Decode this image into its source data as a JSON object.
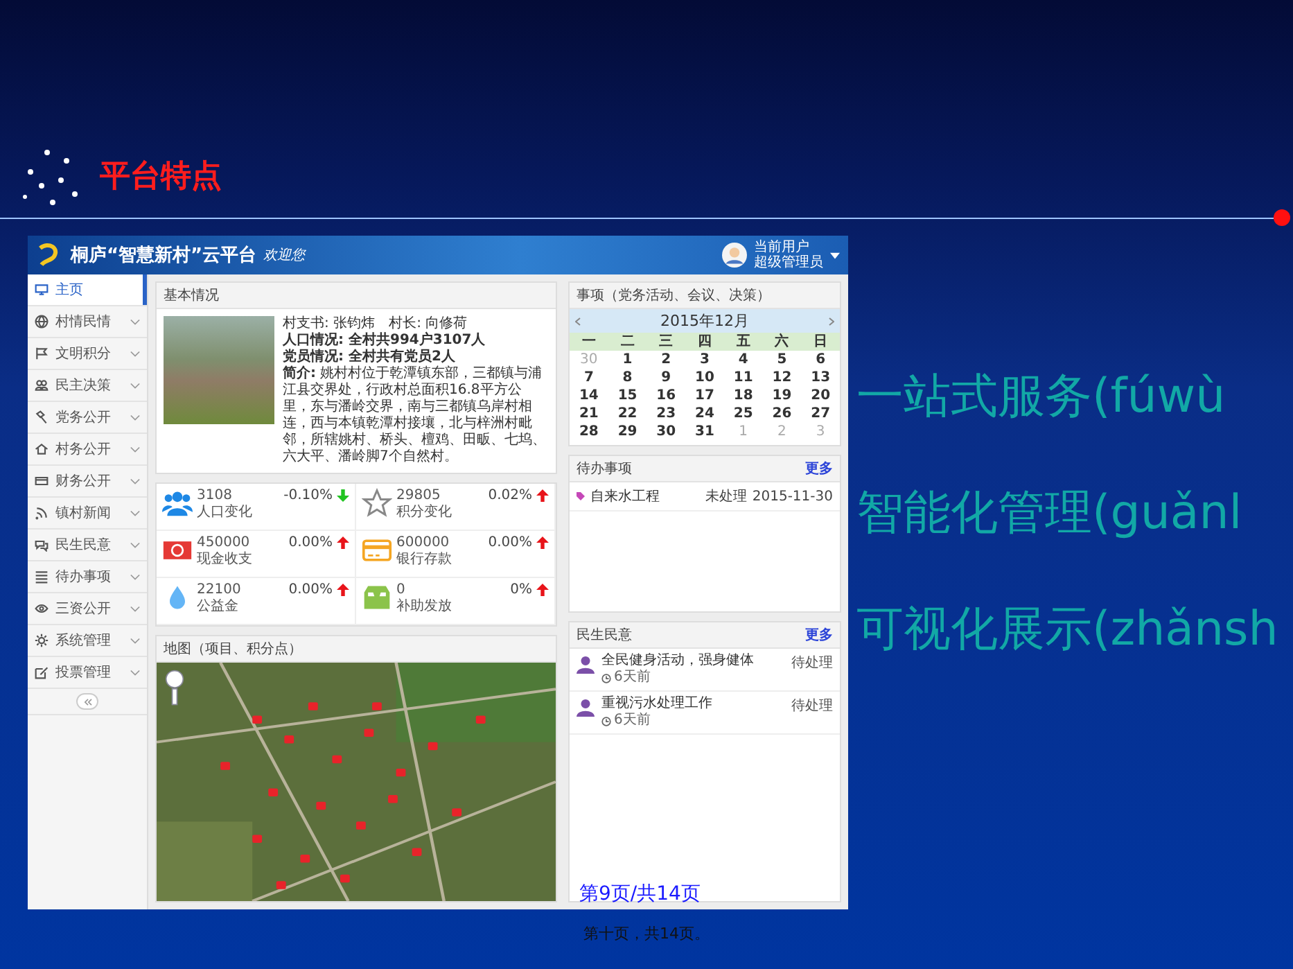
{
  "slide": {
    "title": "平台特点",
    "points": [
      "一站式服务(fúwù",
      "智能化管理(guǎnl",
      "可视化展示(zhǎnsh"
    ],
    "page_note": "第9页/共14页",
    "footer": "第十页，共14页。"
  },
  "app": {
    "brand": "桐庐“智慧新村”云平台",
    "welcome": "欢迎您",
    "user": {
      "role": "当前用户",
      "name": "超级管理员"
    }
  },
  "sidebar": {
    "items": [
      {
        "label": "主页",
        "kind": "monitor",
        "selected": true
      },
      {
        "label": "村情民情",
        "kind": "globe",
        "selected": false
      },
      {
        "label": "文明积分",
        "kind": "flag",
        "selected": false
      },
      {
        "label": "民主决策",
        "kind": "people",
        "selected": false
      },
      {
        "label": "党务公开",
        "kind": "hammer",
        "selected": false
      },
      {
        "label": "村务公开",
        "kind": "house",
        "selected": false
      },
      {
        "label": "财务公开",
        "kind": "card",
        "selected": false
      },
      {
        "label": "镇村新闻",
        "kind": "rss",
        "selected": false
      },
      {
        "label": "民生民意",
        "kind": "chat",
        "selected": false
      },
      {
        "label": "待办事项",
        "kind": "list",
        "selected": false
      },
      {
        "label": "三资公开",
        "kind": "eye",
        "selected": false
      },
      {
        "label": "系统管理",
        "kind": "gear",
        "selected": false
      },
      {
        "label": "投票管理",
        "kind": "edit",
        "selected": false
      }
    ]
  },
  "basic_info": {
    "title": "基本情况",
    "leaders": [
      "村支书: 张钧炜",
      "村长: 向修荷"
    ],
    "lines": [
      {
        "text": "人口情况: 全村共994户3107人",
        "bold": true
      },
      {
        "text": "党员情况: 全村共有党员2人",
        "bold": true
      },
      {
        "text": "**简介:** 姚村村位于乾潭镇东部，三都镇与浦江县交界处，行政村总面积16.8平方公里，东与潘岭交界，南与三都镇乌岸村相连，西与本镇乾潭村接壤，北与梓洲村毗邻，所辖姚村、桥头、檀鸡、田畈、七坞、六大平、潘岭脚7个自然村。",
        "bold": false
      }
    ]
  },
  "stats": [
    {
      "kind": "people",
      "value": "3108",
      "label": "人口变化",
      "change": "-0.10%",
      "rising": false
    },
    {
      "kind": "star",
      "value": "29805",
      "label": "积分变化",
      "change": "0.02%",
      "rising": true
    },
    {
      "kind": "cash",
      "value": "450000",
      "label": "现金收支",
      "change": "0.00%",
      "rising": true
    },
    {
      "kind": "card",
      "value": "600000",
      "label": "银行存款",
      "change": "0.00%",
      "rising": true
    },
    {
      "kind": "drop",
      "value": "22100",
      "label": "公益金",
      "change": "0.00%",
      "rising": true
    },
    {
      "kind": "inbox",
      "value": "0",
      "label": "补助发放",
      "change": "0%",
      "rising": true
    }
  ],
  "map": {
    "title": "地图（项目、积分点）"
  },
  "calendar": {
    "title": "事项（党务活动、会议、决策）",
    "month": "2015年12月",
    "weekdays": [
      "一",
      "二",
      "三",
      "四",
      "五",
      "六",
      "日"
    ],
    "days": [
      {
        "d": "30",
        "muted": true
      },
      {
        "d": "1",
        "muted": false
      },
      {
        "d": "2",
        "muted": false
      },
      {
        "d": "3",
        "muted": false
      },
      {
        "d": "4",
        "muted": false
      },
      {
        "d": "5",
        "muted": false
      },
      {
        "d": "6",
        "muted": false
      },
      {
        "d": "7",
        "muted": false
      },
      {
        "d": "8",
        "muted": false
      },
      {
        "d": "9",
        "muted": false
      },
      {
        "d": "10",
        "muted": false
      },
      {
        "d": "11",
        "muted": false
      },
      {
        "d": "12",
        "muted": false
      },
      {
        "d": "13",
        "muted": false
      },
      {
        "d": "14",
        "muted": false
      },
      {
        "d": "15",
        "muted": false
      },
      {
        "d": "16",
        "muted": false
      },
      {
        "d": "17",
        "muted": false
      },
      {
        "d": "18",
        "muted": false
      },
      {
        "d": "19",
        "muted": false
      },
      {
        "d": "20",
        "muted": false
      },
      {
        "d": "21",
        "muted": false
      },
      {
        "d": "22",
        "muted": false
      },
      {
        "d": "23",
        "muted": false
      },
      {
        "d": "24",
        "muted": false
      },
      {
        "d": "25",
        "muted": false
      },
      {
        "d": "26",
        "muted": false
      },
      {
        "d": "27",
        "muted": false
      },
      {
        "d": "28",
        "muted": false
      },
      {
        "d": "29",
        "muted": false
      },
      {
        "d": "30",
        "muted": false
      },
      {
        "d": "31",
        "muted": false
      },
      {
        "d": "1",
        "muted": true
      },
      {
        "d": "2",
        "muted": true
      },
      {
        "d": "3",
        "muted": true
      }
    ]
  },
  "tasks": {
    "title": "待办事项",
    "more": "更多",
    "items": [
      {
        "title": "自来水工程",
        "status": "未处理",
        "date": "2015-11-30"
      }
    ]
  },
  "opinions": {
    "title": "民生民意",
    "more": "更多",
    "items": [
      {
        "title": "全民健身活动，强身健体",
        "time": "6天前",
        "status": "待处理"
      },
      {
        "title": "重视污水处理工作",
        "time": "6天前",
        "status": "待处理"
      }
    ]
  }
}
